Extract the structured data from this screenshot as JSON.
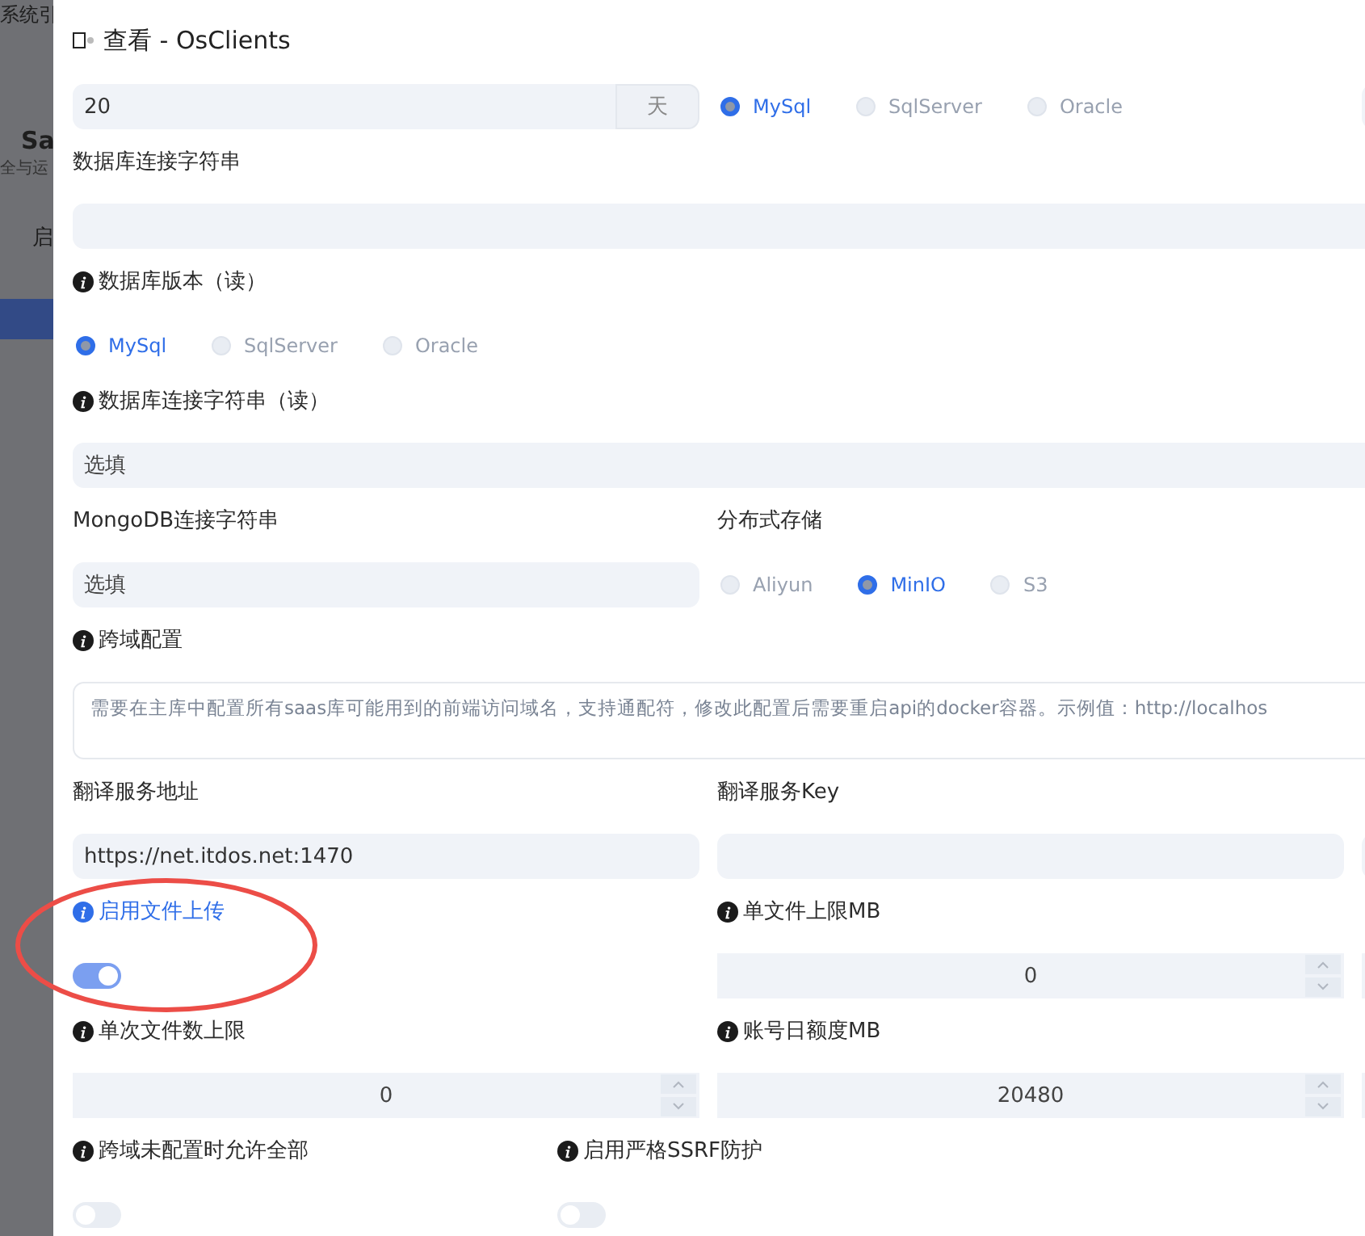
{
  "backdrop": {
    "texts": [
      "系统引",
      "Sa",
      "全与运",
      "启"
    ]
  },
  "title": "查看 - OsClients",
  "rows": [
    {
      "kind": "wide",
      "items": [
        {
          "kind": "addon-input",
          "value": "20",
          "addon": "天"
        },
        {
          "kind": "radio-group",
          "options": [
            {
              "label": "MySql",
              "selected": true
            },
            {
              "label": "SqlServer",
              "selected": false
            },
            {
              "label": "Oracle",
              "selected": false
            }
          ]
        },
        {
          "kind": "input"
        }
      ]
    },
    {
      "kind": "wide",
      "items": [
        {
          "kind": "label",
          "text": "数据库连接字符串"
        }
      ]
    },
    {
      "kind": "wide",
      "items": [
        {
          "kind": "input-full"
        }
      ]
    },
    {
      "kind": "wide",
      "items": [
        {
          "kind": "info-label",
          "text": "数据库版本（读）",
          "highlighted": false
        }
      ]
    },
    {
      "kind": "wide",
      "items": [
        {
          "kind": "radio-group",
          "options": [
            {
              "label": "MySql",
              "selected": true
            },
            {
              "label": "SqlServer",
              "selected": false
            },
            {
              "label": "Oracle",
              "selected": false
            }
          ]
        }
      ]
    },
    {
      "kind": "wide",
      "items": [
        {
          "kind": "info-label",
          "text": "数据库连接字符串（读）",
          "highlighted": false
        }
      ]
    },
    {
      "kind": "wide",
      "items": [
        {
          "kind": "input-full",
          "placeholder": "选填"
        }
      ]
    },
    {
      "kind": "wide",
      "items": [
        {
          "kind": "label",
          "text": "MongoDB连接字符串"
        },
        {
          "kind": "label",
          "text": "分布式存储"
        }
      ]
    },
    {
      "kind": "wide",
      "items": [
        {
          "kind": "input",
          "placeholder": "选填"
        },
        {
          "kind": "radio-group",
          "options": [
            {
              "label": "Aliyun",
              "selected": false
            },
            {
              "label": "MinIO",
              "selected": true
            },
            {
              "label": "S3",
              "selected": false
            }
          ]
        }
      ]
    },
    {
      "kind": "wide",
      "items": [
        {
          "kind": "info-label",
          "text": "跨域配置",
          "highlighted": false
        }
      ]
    },
    {
      "kind": "wide",
      "items": [
        {
          "kind": "textarea",
          "placeholder": "需要在主库中配置所有saas库可能用到的前端访问域名，支持通配符，修改此配置后需要重启api的docker容器。示例值：http://localhos"
        }
      ]
    },
    {
      "kind": "wide",
      "items": [
        {
          "kind": "label",
          "text": "翻译服务地址"
        },
        {
          "kind": "label",
          "text": "翻译服务Key"
        }
      ]
    },
    {
      "kind": "wide",
      "items": [
        {
          "kind": "input",
          "value": "https://net.itdos.net:1470"
        },
        {
          "kind": "input"
        },
        {
          "kind": "input"
        }
      ]
    },
    {
      "kind": "wide",
      "items": [
        {
          "kind": "info-label",
          "text": "启用文件上传",
          "highlighted": true
        },
        {
          "kind": "info-label",
          "text": "单文件上限MB",
          "highlighted": false
        }
      ]
    },
    {
      "kind": "wide",
      "items": [
        {
          "kind": "switch",
          "on": true
        },
        {
          "kind": "number",
          "value": "0"
        },
        {
          "kind": "number"
        }
      ]
    },
    {
      "kind": "wide",
      "items": [
        {
          "kind": "info-label",
          "text": "单次文件数上限",
          "highlighted": false
        },
        {
          "kind": "info-label",
          "text": "账号日额度MB",
          "highlighted": false
        }
      ]
    },
    {
      "kind": "wide",
      "items": [
        {
          "kind": "number",
          "value": "0"
        },
        {
          "kind": "number",
          "value": "20480"
        },
        {
          "kind": "number"
        }
      ]
    },
    {
      "kind": "narrow",
      "items": [
        {
          "kind": "info-label",
          "text": "跨域未配置时允许全部",
          "highlighted": false
        },
        {
          "kind": "info-label",
          "text": "启用严格SSRF防护",
          "highlighted": false
        }
      ]
    },
    {
      "kind": "narrow",
      "items": [
        {
          "kind": "switch",
          "on": false
        },
        {
          "kind": "switch",
          "on": false
        }
      ]
    }
  ]
}
